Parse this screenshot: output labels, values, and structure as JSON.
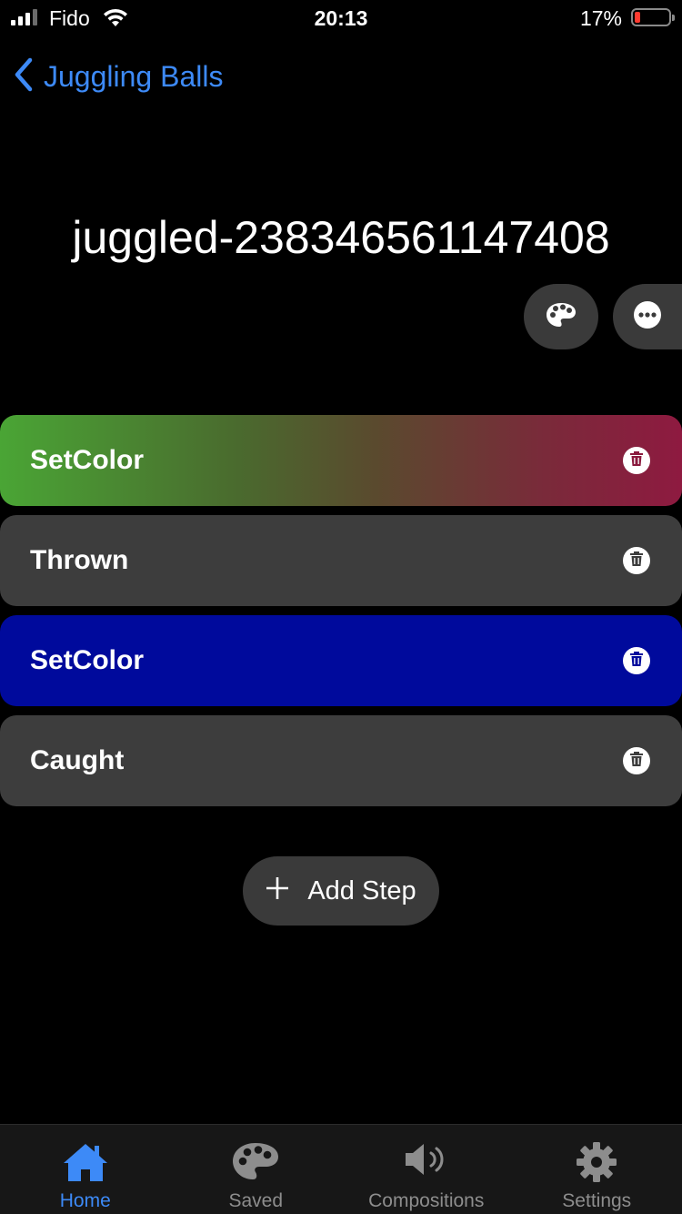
{
  "status_bar": {
    "carrier": "Fido",
    "time": "20:13",
    "battery_percent": "17%",
    "battery_level": 0.17
  },
  "nav": {
    "back_label": "Juggling Balls"
  },
  "title": "juggled-238346561147408",
  "actions": {
    "palette_icon": "palette-icon",
    "more_icon": "ellipsis-icon"
  },
  "steps": [
    {
      "label": "SetColor",
      "style": "gradient",
      "colors": [
        "#4aa535",
        "#5a5a2e",
        "#8a1a3e"
      ]
    },
    {
      "label": "Thrown",
      "style": "plain",
      "colors": [
        "#3d3d3d"
      ]
    },
    {
      "label": "SetColor",
      "style": "solid",
      "colors": [
        "#000a9c"
      ]
    },
    {
      "label": "Caught",
      "style": "plain",
      "colors": [
        "#3d3d3d"
      ]
    }
  ],
  "add_step": {
    "label": "Add Step"
  },
  "tabs": [
    {
      "label": "Home",
      "icon": "home-icon",
      "active": true
    },
    {
      "label": "Saved",
      "icon": "palette-icon",
      "active": false
    },
    {
      "label": "Compositions",
      "icon": "speaker-icon",
      "active": false
    },
    {
      "label": "Settings",
      "icon": "gear-icon",
      "active": false
    }
  ],
  "colors": {
    "accent": "#3d8af7",
    "background": "#000000",
    "card": "#3d3d3d",
    "tab_bar": "#171717"
  }
}
